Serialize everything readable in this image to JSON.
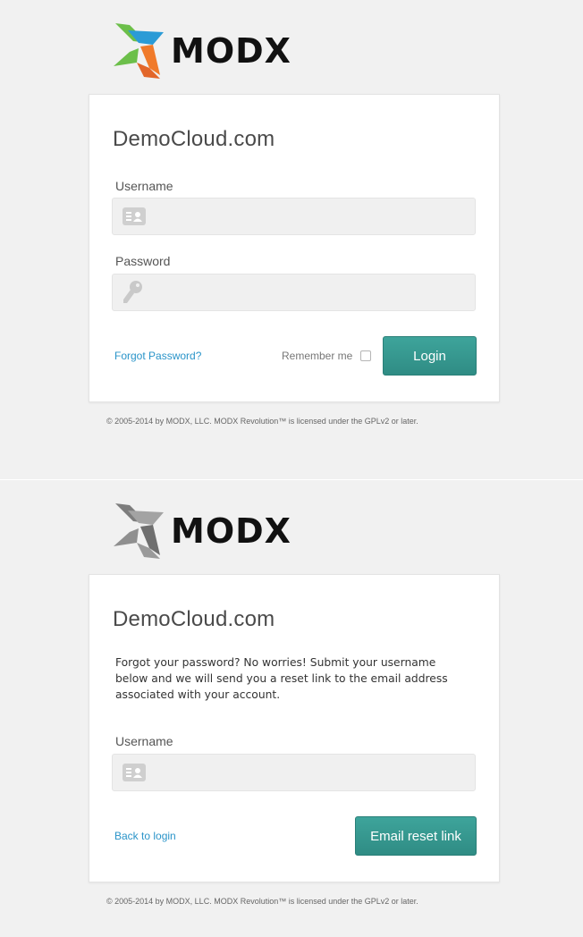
{
  "colors": {
    "accent": "#34978f",
    "link": "#2a94c9",
    "background": "#f1f1f1",
    "logo_blue": "#2b9bd6",
    "logo_green": "#6cbf4a",
    "logo_orange": "#f07a2a",
    "logo_gray": "#8a8a8a"
  },
  "brand": {
    "name": "MODX"
  },
  "login": {
    "site_title": "DemoCloud.com",
    "username_label": "Username",
    "username_value": "",
    "username_icon": "id-card-icon",
    "password_label": "Password",
    "password_value": "",
    "password_icon": "key-icon",
    "forgot_link": "Forgot Password?",
    "remember_label": "Remember me",
    "remember_checked": false,
    "login_button": "Login"
  },
  "forgot": {
    "site_title": "DemoCloud.com",
    "description": "Forgot your password? No worries! Submit your username below and we will send you a reset link to the email address associated with your account.",
    "username_label": "Username",
    "username_value": "",
    "username_icon": "id-card-icon",
    "back_link": "Back to login",
    "submit_button": "Email reset link"
  },
  "footer": {
    "copyright": "© 2005-2014 by MODX, LLC. MODX Revolution™ is licensed under the GPLv2 or later."
  }
}
